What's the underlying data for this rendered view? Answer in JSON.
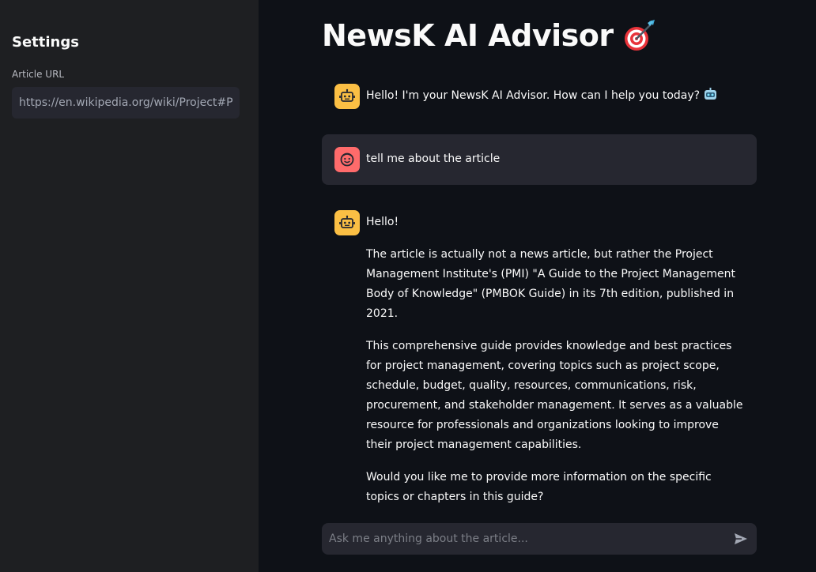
{
  "sidebar": {
    "title": "Settings",
    "url_label": "Article URL",
    "url_value": "https://en.wikipedia.org/wiki/Project#Pr"
  },
  "main": {
    "title": "NewsK AI Advisor",
    "title_emoji": "target-dart-icon"
  },
  "messages": [
    {
      "role": "assistant",
      "avatar": "robot-face-icon",
      "paragraphs": [
        "Hello! I'm your NewsK AI Advisor. How can I help you today?"
      ],
      "trailing_emoji": "robot-emoji-icon"
    },
    {
      "role": "user",
      "avatar": "smiling-face-icon",
      "paragraphs": [
        "tell me about the article"
      ]
    },
    {
      "role": "assistant",
      "avatar": "robot-face-icon",
      "paragraphs": [
        "Hello!",
        "The article is actually not a news article, but rather the Project Management Institute's (PMI) \"A Guide to the Project Management Body of Knowledge\" (PMBOK Guide) in its 7th edition, published in 2021.",
        "This comprehensive guide provides knowledge and best practices for project management, covering topics such as project scope, schedule, budget, quality, resources, communications, risk, procurement, and stakeholder management. It serves as a valuable resource for professionals and organizations looking to improve their project management capabilities.",
        "Would you like me to provide more information on the specific topics or chapters in this guide?"
      ]
    }
  ],
  "chat_input": {
    "placeholder": "Ask me anything about the article...",
    "value": "",
    "send_icon": "send-arrow-icon"
  },
  "colors": {
    "background": "#0e1117",
    "sidebar": "#1e1f22",
    "input": "#262730",
    "bot_avatar": "#fbbf44",
    "user_avatar": "#ff6b6b"
  }
}
